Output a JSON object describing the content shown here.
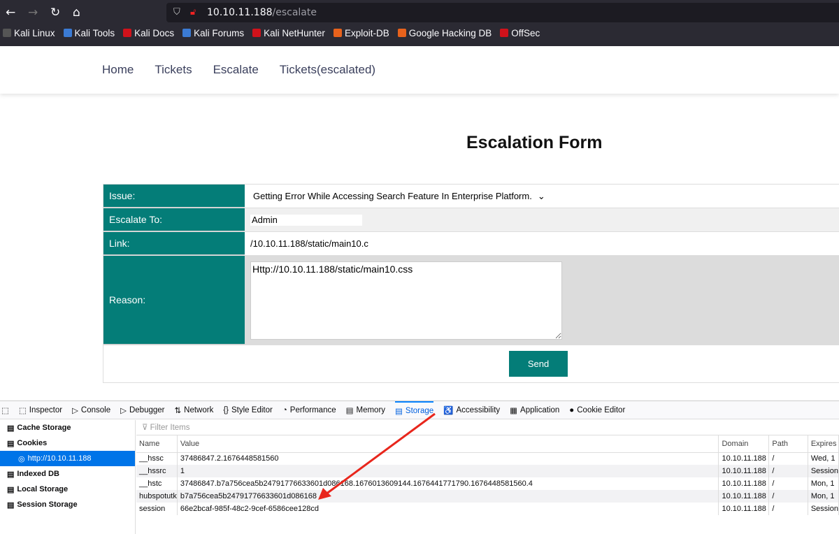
{
  "browser": {
    "url_host": "10.10.11.188",
    "url_path": "/escalate",
    "bookmarks": [
      {
        "label": "Kali Linux",
        "color": "#555"
      },
      {
        "label": "Kali Tools",
        "color": "#3b7bd4"
      },
      {
        "label": "Kali Docs",
        "color": "#d0121b"
      },
      {
        "label": "Kali Forums",
        "color": "#3b7bd4"
      },
      {
        "label": "Kali NetHunter",
        "color": "#d0121b"
      },
      {
        "label": "Exploit-DB",
        "color": "#e8621c"
      },
      {
        "label": "Google Hacking DB",
        "color": "#e8621c"
      },
      {
        "label": "OffSec",
        "color": "#d0121b"
      }
    ]
  },
  "site": {
    "nav": [
      "Home",
      "Tickets",
      "Escalate",
      "Tickets(escalated)"
    ],
    "title": "Escalation Form",
    "form": {
      "issue_label": "Issue:",
      "issue_value": "Getting Error While Accessing Search Feature In Enterprise Platform.",
      "escalate_label": "Escalate To:",
      "escalate_value": "Admin",
      "link_label": "Link:",
      "link_value": "/10.10.11.188/static/main10.c",
      "reason_label": "Reason:",
      "reason_value": "Http://10.10.11.188/static/main10.css",
      "send": "Send"
    },
    "accent": "#047d78"
  },
  "devtools": {
    "tabs": [
      "Inspector",
      "Console",
      "Debugger",
      "Network",
      "Style Editor",
      "Performance",
      "Memory",
      "Storage",
      "Accessibility",
      "Application",
      "Cookie Editor"
    ],
    "active_tab": "Storage",
    "sidebar": [
      "Cache Storage",
      "Cookies",
      "http://10.10.11.188",
      "Indexed DB",
      "Local Storage",
      "Session Storage"
    ],
    "filter_placeholder": "Filter Items",
    "columns": [
      "Name",
      "Value",
      "Domain",
      "Path",
      "Expires"
    ],
    "rows": [
      [
        "__hssc",
        "37486847.2.1676448581560",
        "10.10.11.188",
        "/",
        "Wed, 1"
      ],
      [
        "__hssrc",
        "1",
        "10.10.11.188",
        "/",
        "Session"
      ],
      [
        "__hstc",
        "37486847.b7a756cea5b24791776633601d086168.1676013609144.1676441771790.1676448581560.4",
        "10.10.11.188",
        "/",
        "Mon, 1"
      ],
      [
        "hubspotutk",
        "b7a756cea5b24791776633601d086168",
        "10.10.11.188",
        "/",
        "Mon, 1"
      ],
      [
        "session",
        "66e2bcaf-985f-48c2-9cef-6586cee128cd",
        "10.10.11.188",
        "/",
        "Session"
      ]
    ]
  }
}
